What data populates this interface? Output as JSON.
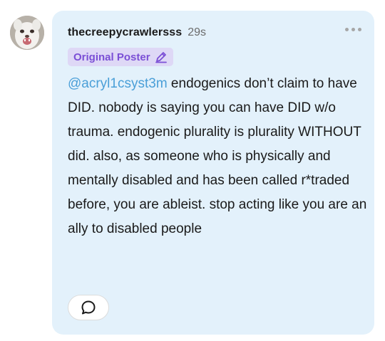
{
  "post": {
    "username": "thecreepycrawlersss",
    "timestamp": "29s",
    "badge_label": "Original Poster",
    "mention": "@acryl1csyst3m",
    "body": " endogenics don’t claim to have DID. nobody is saying you can have DID w/o trauma. endogenic plurality is plurality WITHOUT did. also, as someone who is physically and mentally disabled and has been called r*traded before, you are ableist. stop acting like you are an ally to disabled people"
  },
  "icons": {
    "more": "more-horizontal-icon",
    "badge": "pencil-icon",
    "comment": "speech-bubble-icon"
  },
  "colors": {
    "bubble_background": "#e3f1fb",
    "badge_background": "#ded8f6",
    "badge_text": "#7b4fd6",
    "mention": "#4a9fd8",
    "timestamp": "#6b6b6b"
  }
}
